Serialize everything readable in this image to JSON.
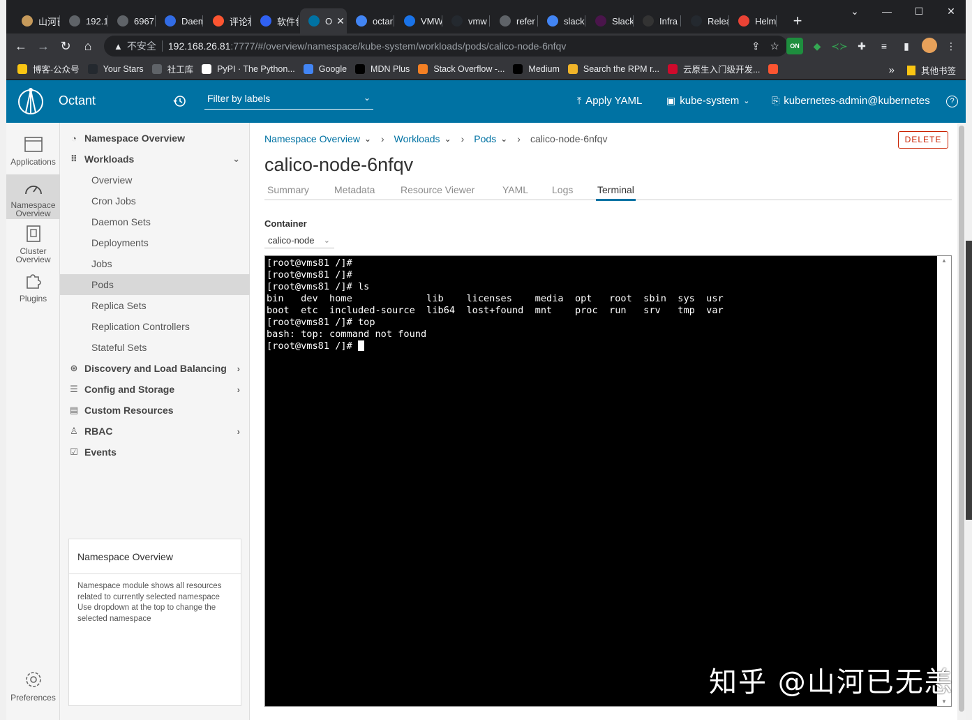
{
  "browser": {
    "tabs": [
      {
        "label": "山河已",
        "fav_color": "#c69a5b"
      },
      {
        "label": "192.1",
        "fav_color": "#5f6368"
      },
      {
        "label": "6967",
        "fav_color": "#5f6368"
      },
      {
        "label": "Daem",
        "fav_color": "#326ce5"
      },
      {
        "label": "评论和",
        "fav_color": "#fc5531"
      },
      {
        "label": "软件包",
        "fav_color": "#3061f2"
      },
      {
        "label": "O",
        "fav_color": "#0072a3"
      },
      {
        "label": "octar",
        "fav_color": "#4285f4"
      },
      {
        "label": "VMW",
        "fav_color": "#1a73e8"
      },
      {
        "label": "vmw",
        "fav_color": "#24292f"
      },
      {
        "label": "refer",
        "fav_color": "#5f6368"
      },
      {
        "label": "slack",
        "fav_color": "#4285f4"
      },
      {
        "label": "Slack",
        "fav_color": "#4a154b"
      },
      {
        "label": "Infra",
        "fav_color": "#333333"
      },
      {
        "label": "Relea",
        "fav_color": "#24292f"
      },
      {
        "label": "Helm",
        "fav_color": "#ea4335"
      }
    ],
    "new_tab": "+",
    "address": {
      "insecure_label": "不安全",
      "host": "192.168.26.81",
      "path": ":7777/#/overview/namespace/kube-system/workloads/pods/calico-node-6nfqv"
    },
    "extension_on_label": "ON",
    "bookmarks": [
      {
        "label": "博客-公众号",
        "color": "#f9c513"
      },
      {
        "label": "Your Stars",
        "color": "#24292f"
      },
      {
        "label": "社工库",
        "color": "#5f6368"
      },
      {
        "label": "PyPI · The Python...",
        "color": "#ffffff"
      },
      {
        "label": "Google",
        "color": "#4285f4"
      },
      {
        "label": "MDN Plus",
        "color": "#000000"
      },
      {
        "label": "Stack Overflow -...",
        "color": "#f48024"
      },
      {
        "label": "Medium",
        "color": "#000000"
      },
      {
        "label": "Search the RPM r...",
        "color": "#f0b429"
      },
      {
        "label": "云原生入门级开发...",
        "color": "#cf0a2c"
      },
      {
        "label": "",
        "color": "#fc5531"
      }
    ],
    "bookmarks_more": "»",
    "other_bookmarks": "其他书签"
  },
  "header": {
    "brand": "Octant",
    "filter_placeholder": "Filter by labels",
    "apply_yaml": "Apply YAML",
    "namespace": "kube-system",
    "context": "kubernetes-admin@kubernetes",
    "help": "?"
  },
  "rail": [
    {
      "label": "Applications"
    },
    {
      "label": "Namespace Overview"
    },
    {
      "label": "Cluster Overview"
    },
    {
      "label": "Plugins"
    },
    {
      "label": "Preferences"
    }
  ],
  "nav": {
    "namespace_overview": "Namespace Overview",
    "workloads": "Workloads",
    "workload_items": [
      "Overview",
      "Cron Jobs",
      "Daemon Sets",
      "Deployments",
      "Jobs",
      "Pods",
      "Replica Sets",
      "Replication Controllers",
      "Stateful Sets"
    ],
    "discovery": "Discovery and Load Balancing",
    "config": "Config and Storage",
    "custom": "Custom Resources",
    "rbac": "RBAC",
    "events": "Events",
    "help_title": "Namespace Overview",
    "help_body": "Namespace module shows all resources related to currently selected namespace Use dropdown at the top to change the selected namespace"
  },
  "main": {
    "breadcrumbs": [
      "Namespace Overview",
      "Workloads",
      "Pods"
    ],
    "breadcrumb_current": "calico-node-6nfqv",
    "delete": "DELETE",
    "title": "calico-node-6nfqv",
    "tabs": [
      "Summary",
      "Metadata",
      "Resource Viewer",
      "YAML",
      "Logs",
      "Terminal"
    ],
    "active_tab": "Terminal",
    "container_label": "Container",
    "container_value": "calico-node",
    "terminal_lines": [
      "[root@vms81 /]#",
      "[root@vms81 /]#",
      "[root@vms81 /]# ls",
      "bin   dev  home             lib    licenses    media  opt   root  sbin  sys  usr",
      "boot  etc  included-source  lib64  lost+found  mnt    proc  run   srv   tmp  var",
      "[root@vms81 /]# top",
      "bash: top: command not found",
      "[root@vms81 /]# "
    ]
  },
  "watermark": "知乎 @山河已无恙"
}
